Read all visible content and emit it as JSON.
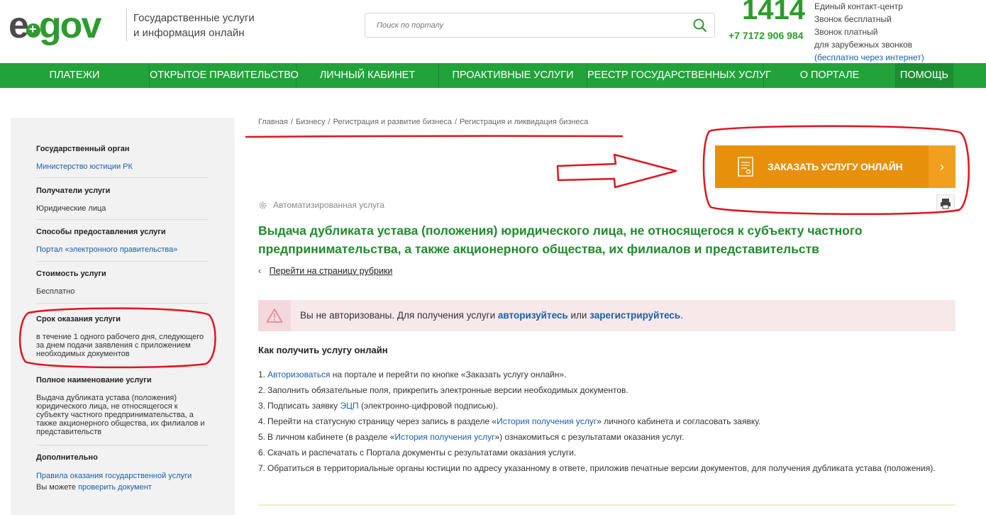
{
  "header": {
    "logo_e": "e",
    "logo_gov": "gov",
    "tagline_line1": "Государственные услуги",
    "tagline_line2": "и информация онлайн",
    "search_placeholder": "Поиск по порталу",
    "contact_number": "1414",
    "contact_phone": "+7 7172 906 984",
    "contact_lines": [
      "Единый контакт-центр",
      "Звонок бесплатный",
      "Звонок платный",
      "для зарубежных звонков"
    ],
    "contact_free_internet": "(бесплатно через интернет)"
  },
  "nav": [
    {
      "label": "ПЛАТЕЖИ",
      "active": false
    },
    {
      "label": "ОТКРЫТОЕ ПРАВИТЕЛЬСТВО",
      "active": false
    },
    {
      "label": "ЛИЧНЫЙ КАБИНЕТ",
      "active": false
    },
    {
      "label": "ПРОАКТИВНЫЕ УСЛУГИ",
      "active": false
    },
    {
      "label": "РЕЕСТР ГОСУДАРСТВЕННЫХ УСЛУГ",
      "active": false
    },
    {
      "label": "О ПОРТАЛЕ",
      "active": false
    },
    {
      "label": "ПОМОЩЬ",
      "active": true
    }
  ],
  "sidebar": {
    "gov_body_title": "Государственный орган",
    "gov_body_value": "Министерство юстиции РК",
    "recipients_title": "Получатели услуги",
    "recipients_value": "Юридические лица",
    "methods_title": "Способы предоставления услуги",
    "methods_value": "Портал «электронного правительства»",
    "cost_title": "Стоимость услуги",
    "cost_value": "Бесплатно",
    "term_title": "Срок оказания услуги",
    "term_value": "в течение 1 одного рабочего дня, следующего за днем подачи заявления с приложением необходимых документов",
    "fullname_title": "Полное наименование услуги",
    "fullname_value": "Выдача дубликата устава (положения) юридического лица, не относящегося к субъекту частного предпринимательства, а также акционерного общества, их филиалов и представительств",
    "extra_title": "Дополнительно",
    "extra_rules_link": "Правила оказания государственной услуги",
    "extra_check_prefix": "Вы можете",
    "extra_check_link": "проверить документ"
  },
  "breadcrumb": [
    "Главная",
    "Бизнесу",
    "Регистрация и развитие бизнеса",
    "Регистрация и ликвидация бизнеса"
  ],
  "breadcrumb_sep": "/",
  "order_button": {
    "label": "ЗАКАЗАТЬ УСЛУГУ ОНЛАЙН",
    "arrow": "›"
  },
  "service_type": "Автоматизированная услуга",
  "service_title": "Выдача дубликата устава (положения) юридического лица, не относящегося к субъекту частного предпринимательства, а также акционерного общества, их филиалов и представительств",
  "back_link": {
    "chevron": "‹",
    "label": "Перейти на страницу рубрики"
  },
  "alert": {
    "text1": "Вы не авторизованы. Для получения услуги",
    "link1": "авторизуйтесь",
    "text2": "или",
    "link2": "зарегистрируйтесь",
    "text3": "."
  },
  "how_title": "Как получить услугу онлайн",
  "steps": {
    "s1_num": "1.",
    "s1_link": "Авторизоваться",
    "s1_text": " на портале и перейти по кнопке «Заказать услугу онлайн».",
    "s2_num": "2.",
    "s2_text": "Заполнить обязательные поля, прикрепить электронные версии необходимых документов.",
    "s3_num": "3.",
    "s3_pre": "Подписать заявку ",
    "s3_link": "ЭЦП",
    "s3_post": " (электронно-цифровой подписью).",
    "s4_num": "4.",
    "s4_pre": "Перейти на статусную страницу через запись в разделе «",
    "s4_link": "История получения услуг",
    "s4_post": "» личного кабинета и согласовать заявку.",
    "s5_num": "5.",
    "s5_pre": "В личном кабинете (в разделе «",
    "s5_link": "История получения услуг",
    "s5_post": "») ознакомиться с результатами оказания услуг.",
    "s6_num": "6.",
    "s6_text": "Скачать и распечатать с Портала документы с результатами оказания услуги.",
    "s7_num": "7.",
    "s7_text": "Обратиться в территориальные органы юстиции по адресу указанному в ответе, приложив печатные версии документов, для получения дубликата устава (положения)."
  },
  "colors": {
    "brand_green": "#21a33a",
    "title_green": "#1e8c2c",
    "order_orange": "#e6900c",
    "annotation_red": "#e0141e"
  }
}
